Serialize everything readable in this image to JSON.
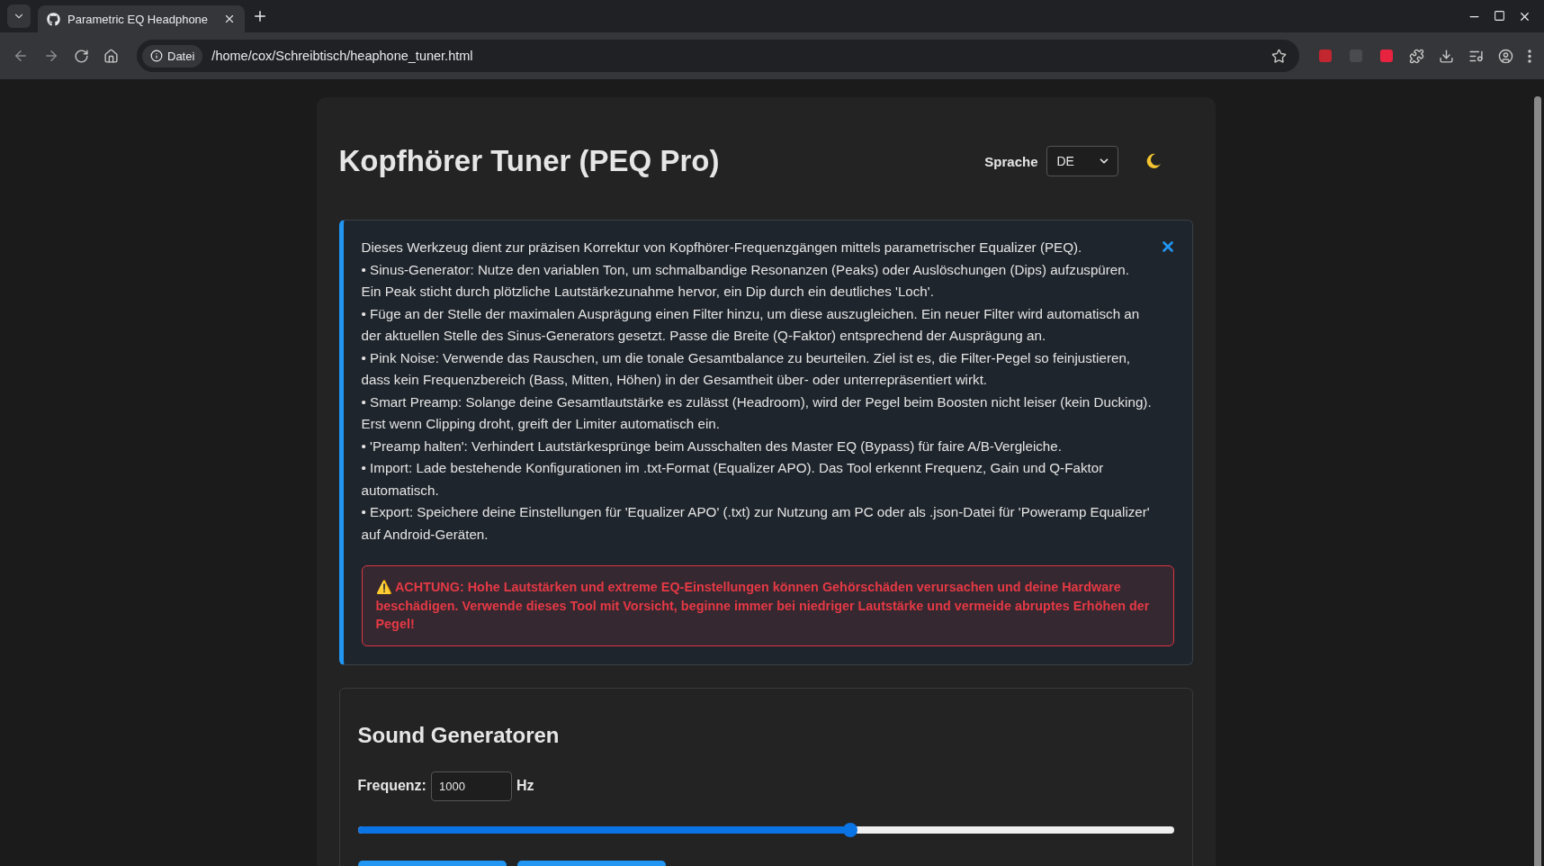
{
  "browser": {
    "tab_title": "Parametric EQ Headphone",
    "address_badge": "Datei",
    "url": "/home/cox/Schreibtisch/heaphone_tuner.html"
  },
  "header": {
    "title": "Kopfhörer Tuner (PEQ Pro)",
    "language_label": "Sprache",
    "language_value": "DE"
  },
  "info": {
    "paragraphs": [
      "Dieses Werkzeug dient zur präzisen Korrektur von Kopfhörer-Frequenzgängen mittels parametrischer Equalizer (PEQ).",
      "• Sinus-Generator: Nutze den variablen Ton, um schmalbandige Resonanzen (Peaks) oder Auslöschungen (Dips) aufzuspüren.",
      "Ein Peak sticht durch plötzliche Lautstärkezunahme hervor, ein Dip durch ein deutliches 'Loch'.",
      "• Füge an der Stelle der maximalen Ausprägung einen Filter hinzu, um diese auszugleichen. Ein neuer Filter wird automatisch an der aktuellen Stelle des Sinus-Generators gesetzt. Passe die Breite (Q-Faktor) entsprechend der Ausprägung an.",
      "• Pink Noise: Verwende das Rauschen, um die tonale Gesamtbalance zu beurteilen. Ziel ist es, die Filter-Pegel so feinjustieren, dass kein Frequenzbereich (Bass, Mitten, Höhen) in der Gesamtheit über- oder unterrepräsentiert wirkt.",
      "• Smart Preamp: Solange deine Gesamtlautstärke es zulässt (Headroom), wird der Pegel beim Boosten nicht leiser (kein Ducking). Erst wenn Clipping droht, greift der Limiter automatisch ein.",
      "• 'Preamp halten': Verhindert Lautstärkesprünge beim Ausschalten des Master EQ (Bypass) für faire A/B-Vergleiche.",
      "• Import: Lade bestehende Konfigurationen im .txt-Format (Equalizer APO). Das Tool erkennt Frequenz, Gain und Q-Faktor automatisch.",
      "• Export: Speichere deine Einstellungen für 'Equalizer APO' (.txt) zur Nutzung am PC oder als .json-Datei für 'Poweramp Equalizer' auf Android-Geräten."
    ],
    "warning": "⚠️ ACHTUNG: Hohe Lautstärken und extreme EQ-Einstellungen können Gehörschäden verursachen und deine Hardware beschädigen. Verwende dieses Tool mit Vorsicht, beginne immer bei niedriger Lautstärke und vermeide abruptes Erhöhen der Pegel!"
  },
  "sound": {
    "title": "Sound Generatoren",
    "frequency_label": "Frequenz:",
    "frequency_value": "1000",
    "unit": "Hz",
    "slider": {
      "level": 0.604
    }
  }
}
